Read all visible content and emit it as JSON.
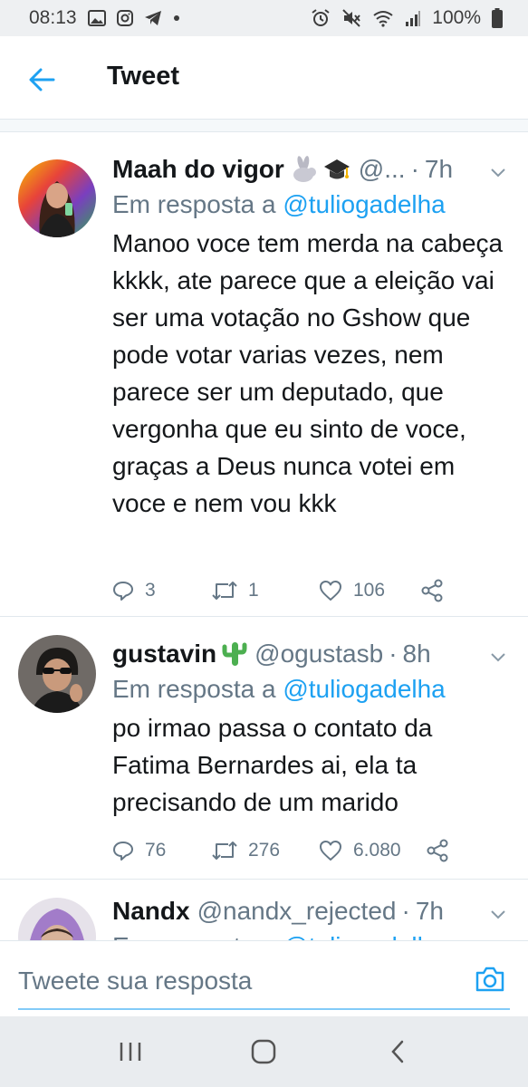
{
  "status_bar": {
    "time": "08:13",
    "battery": "100%",
    "icons_left": [
      "gallery-icon",
      "instagram-icon",
      "telegram-icon",
      "dot-icon"
    ],
    "icons_right": [
      "alarm-icon",
      "mute-icon",
      "wifi-icon",
      "signal-icon",
      "battery-icon"
    ]
  },
  "header": {
    "title": "Tweet"
  },
  "tweets": [
    {
      "name": "Maah do vigor",
      "emojis": [
        "rabbit-emoji",
        "graduation-cap-emoji"
      ],
      "handle": "@...",
      "time": "7h",
      "reply_prefix": "Em resposta a",
      "reply_mention": "@tuliogadelha",
      "text": "Manoo voce tem merda na cabeça kkkk, ate parece que a eleição vai ser uma votação no Gshow que pode votar varias vezes, nem parece ser um deputado, que vergonha que eu sinto de voce, graças a Deus nunca votei em voce e nem vou kkk",
      "replies": "3",
      "retweets": "1",
      "likes": "106"
    },
    {
      "name": "gustavin",
      "emojis": [
        "cactus-emoji"
      ],
      "handle": "@ogustasb",
      "time": "8h",
      "reply_prefix": "Em resposta a",
      "reply_mention": "@tuliogadelha",
      "text": "po irmao passa o contato da Fatima Bernardes ai, ela ta precisando de um marido",
      "replies": "76",
      "retweets": "276",
      "likes": "6.080"
    },
    {
      "name": "Nandx",
      "emojis": [],
      "handle": "@nandx_rejected",
      "time": "7h",
      "reply_prefix": "Em resposta a",
      "reply_mention": "@tuliogadelha"
    }
  ],
  "composer": {
    "placeholder": "Tweete sua resposta"
  },
  "colors": {
    "accent": "#1da1f2",
    "secondary_text": "#657786",
    "primary_text": "#14171a",
    "divider": "#e1e8ed"
  }
}
